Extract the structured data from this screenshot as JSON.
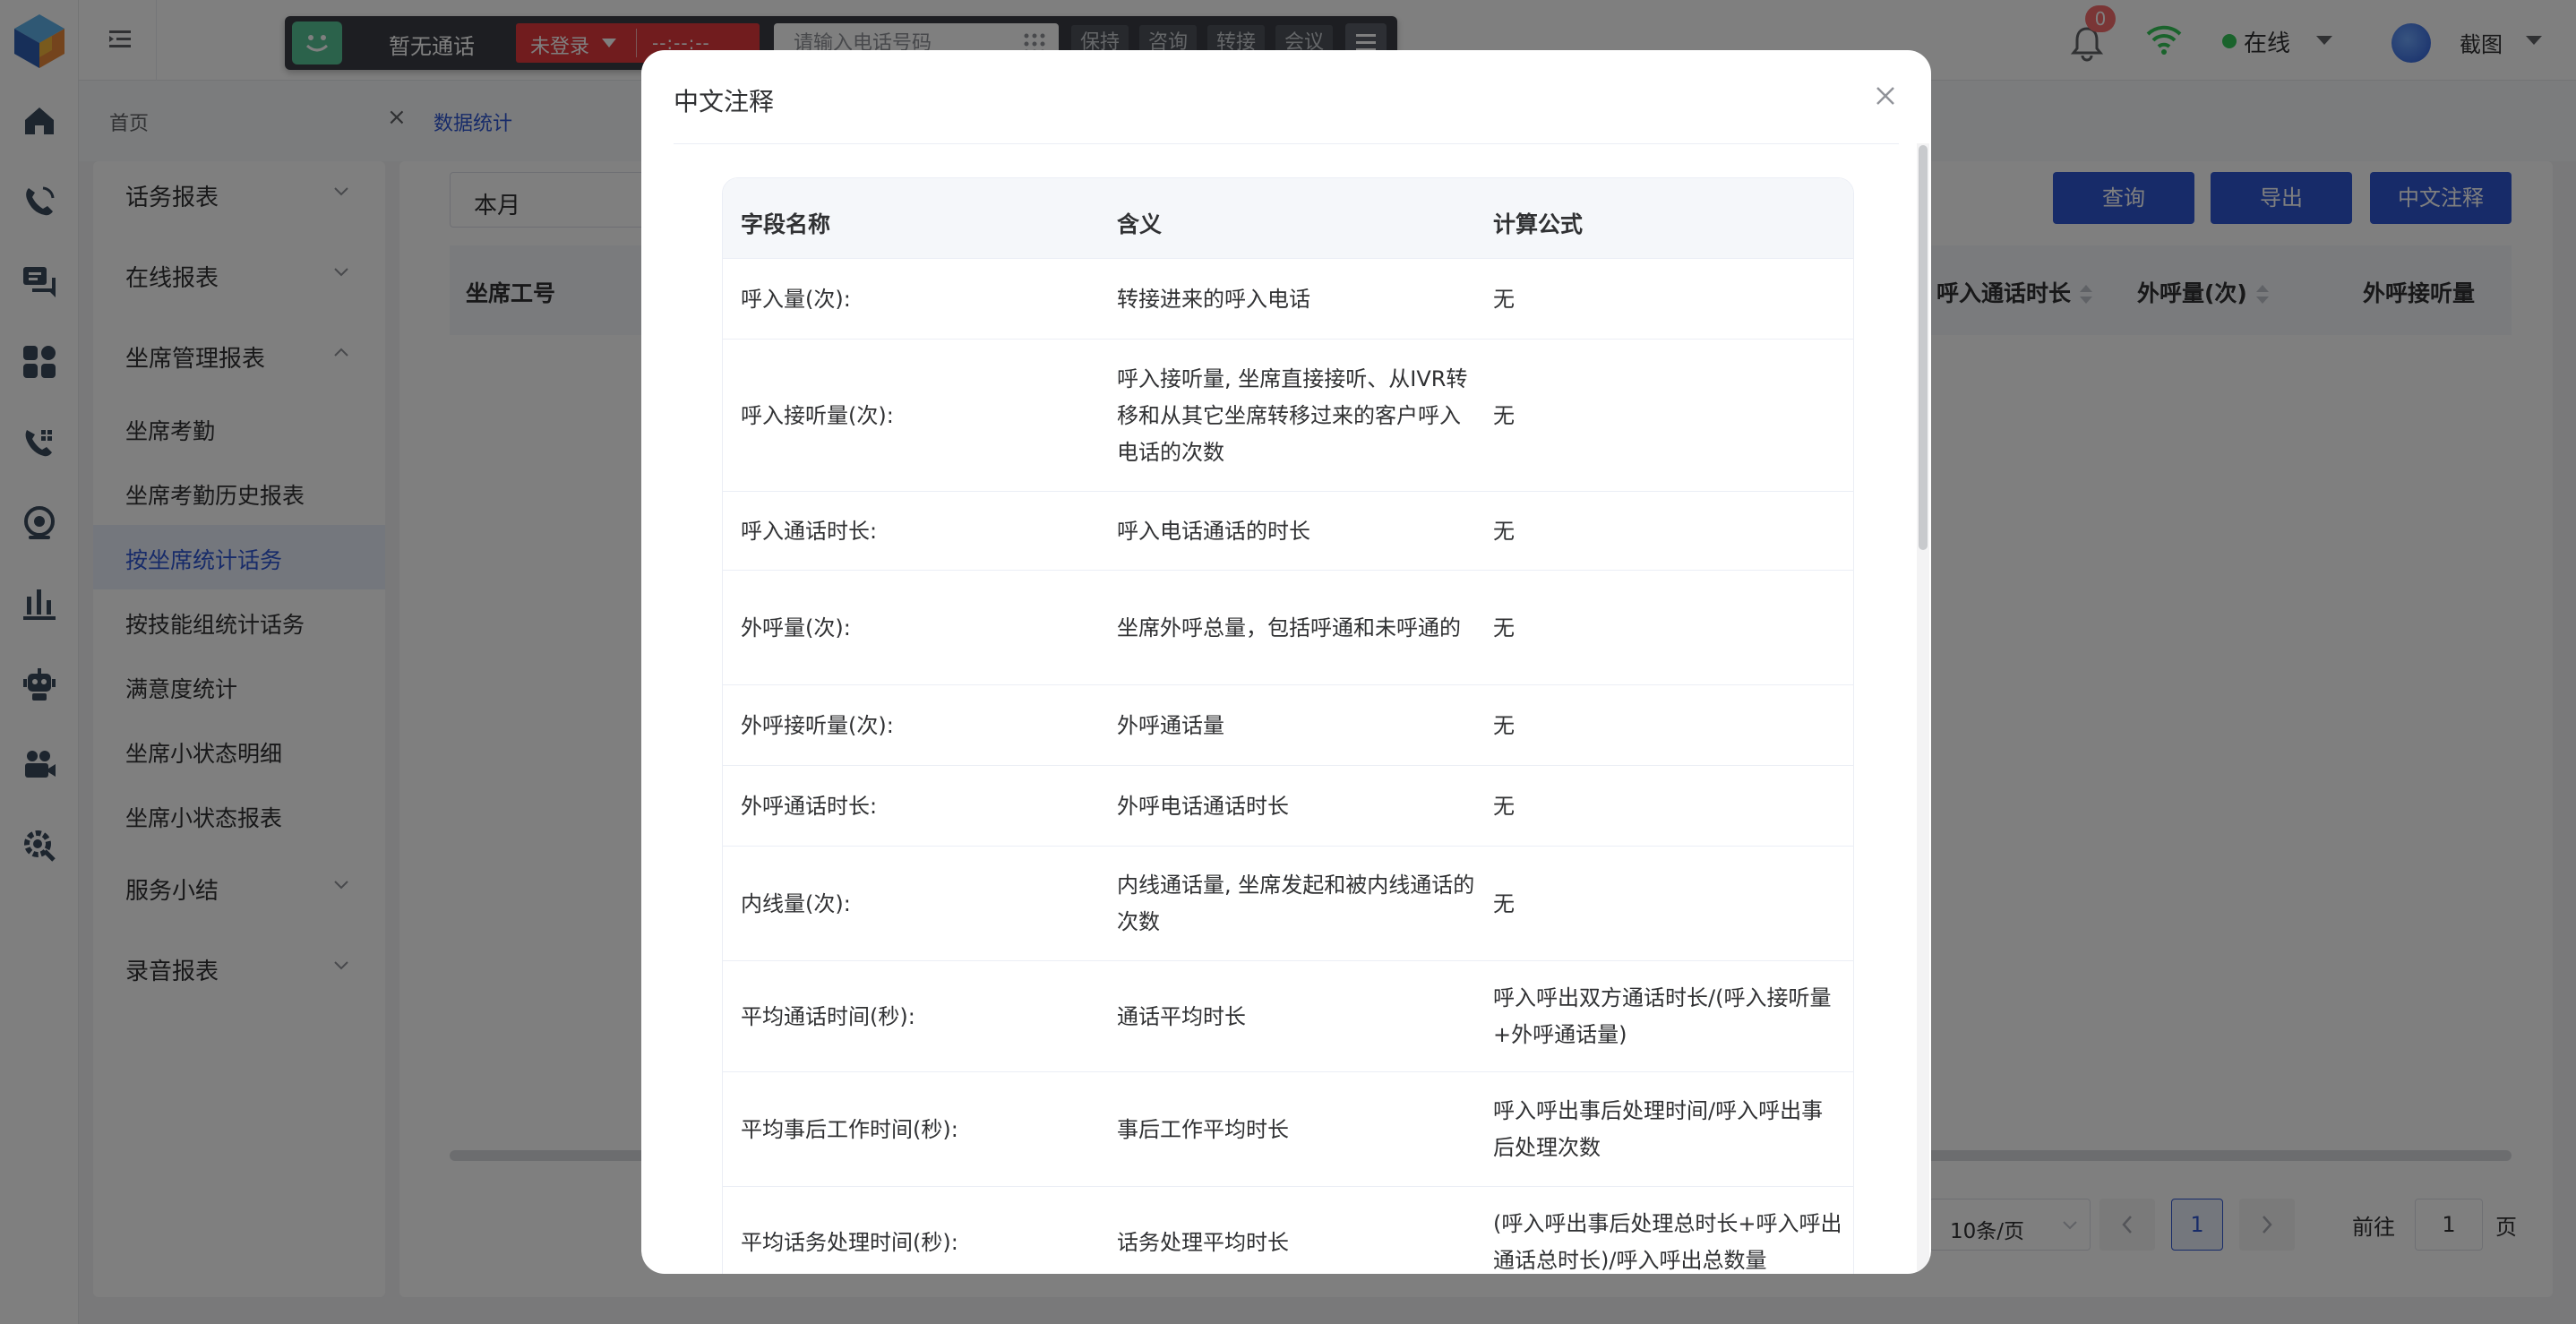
{
  "topbar": {
    "notifications_count": "0",
    "status_label": "在线",
    "user_name": "截图"
  },
  "phonebar": {
    "call_status": "暂无通话",
    "login_status": "未登录",
    "timer": "--:--:--",
    "phone_placeholder": "请输入电话号码",
    "buttons": [
      "保持",
      "咨询",
      "转接",
      "会议"
    ]
  },
  "breadcrumb": {
    "home": "首页",
    "active": "数据统计"
  },
  "menu": {
    "items": [
      {
        "label": "话务报表"
      },
      {
        "label": "在线报表"
      },
      {
        "label": "坐席管理报表"
      },
      {
        "label": "坐席考勤"
      },
      {
        "label": "坐席考勤历史报表"
      },
      {
        "label": "按坐席统计话务"
      },
      {
        "label": "按技能组统计话务"
      },
      {
        "label": "满意度统计"
      },
      {
        "label": "坐席小状态明细"
      },
      {
        "label": "坐席小状态报表"
      },
      {
        "label": "服务小结"
      },
      {
        "label": "录音报表"
      }
    ]
  },
  "content": {
    "period": "本月",
    "buttons": {
      "query": "查询",
      "export": "导出",
      "notes": "中文注释"
    },
    "columns": [
      "坐席工号",
      "呼入通话时长",
      "外呼量(次)",
      "外呼接听量"
    ],
    "pagination": {
      "page_size": "10条/页",
      "current_page": "1",
      "goto_label": "前往",
      "goto_value": "1",
      "page_suffix": "页"
    }
  },
  "modal": {
    "title": "中文注释",
    "headers": [
      "字段名称",
      "含义",
      "计算公式"
    ],
    "rows": [
      {
        "field": "呼入量(次):",
        "meaning": "转接进来的呼入电话",
        "formula": "无"
      },
      {
        "field": "呼入接听量(次):",
        "meaning": "呼入接听量, 坐席直接接听、从IVR转移和从其它坐席转移过来的客户呼入电话的次数",
        "formula": "无"
      },
      {
        "field": "呼入通话时长:",
        "meaning": "呼入电话通话的时长",
        "formula": "无"
      },
      {
        "field": "外呼量(次):",
        "meaning": "坐席外呼总量，包括呼通和未呼通的",
        "formula": "无"
      },
      {
        "field": "外呼接听量(次):",
        "meaning": "外呼通话量",
        "formula": "无"
      },
      {
        "field": "外呼通话时长:",
        "meaning": "外呼电话通话时长",
        "formula": "无"
      },
      {
        "field": "内线量(次):",
        "meaning": "内线通话量, 坐席发起和被内线通话的次数",
        "formula": "无"
      },
      {
        "field": "平均通话时间(秒):",
        "meaning": "通话平均时长",
        "formula": "呼入呼出双方通话时长/(呼入接听量+外呼通话量)"
      },
      {
        "field": "平均事后工作时间(秒):",
        "meaning": "事后工作平均时长",
        "formula": "呼入呼出事后处理时间/呼入呼出事后处理次数"
      },
      {
        "field": "平均话务处理时间(秒):",
        "meaning": "话务处理平均时长",
        "formula": "(呼入呼出事后处理总时长+呼入呼出通话总时长)/呼入呼出总数量"
      }
    ]
  },
  "colors": {
    "accent": "#2f56d3",
    "login_red": "#e3393c",
    "online_green": "#34c759",
    "badge_red": "#f56c6c"
  },
  "icons": [
    "logo-icon",
    "home-icon",
    "phone-icon",
    "chat-icon",
    "apps-icon",
    "call-icon",
    "camera-icon",
    "chart-icon",
    "robot-icon",
    "video-icon",
    "settings-icon",
    "bell-icon",
    "wifi-icon",
    "close-icon",
    "dialpad-icon",
    "menu-icon",
    "smile-icon"
  ]
}
